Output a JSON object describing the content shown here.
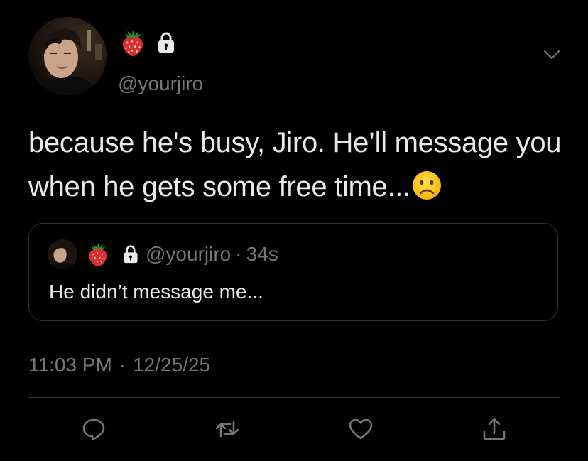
{
  "tweet": {
    "handle": "@yourjiro",
    "text": "because he's busy, Jiro. He’ll message you when he gets some free time...",
    "timestamp_time": "11:03 PM",
    "timestamp_sep": "·",
    "timestamp_date": "12/25/25"
  },
  "quoted": {
    "handle": "@yourjiro",
    "dot": "·",
    "time": "34s",
    "text": "He didn’t message me..."
  },
  "icons": {
    "header": [
      "strawberry-emoji",
      "lock-icon",
      "chevron-down-icon"
    ],
    "actions": [
      "reply-icon",
      "retweet-icon",
      "like-icon",
      "share-icon"
    ]
  },
  "colors": {
    "background": "#000000",
    "text": "#e7e9ea",
    "secondary": "#71767b",
    "border": "#2f3336"
  }
}
